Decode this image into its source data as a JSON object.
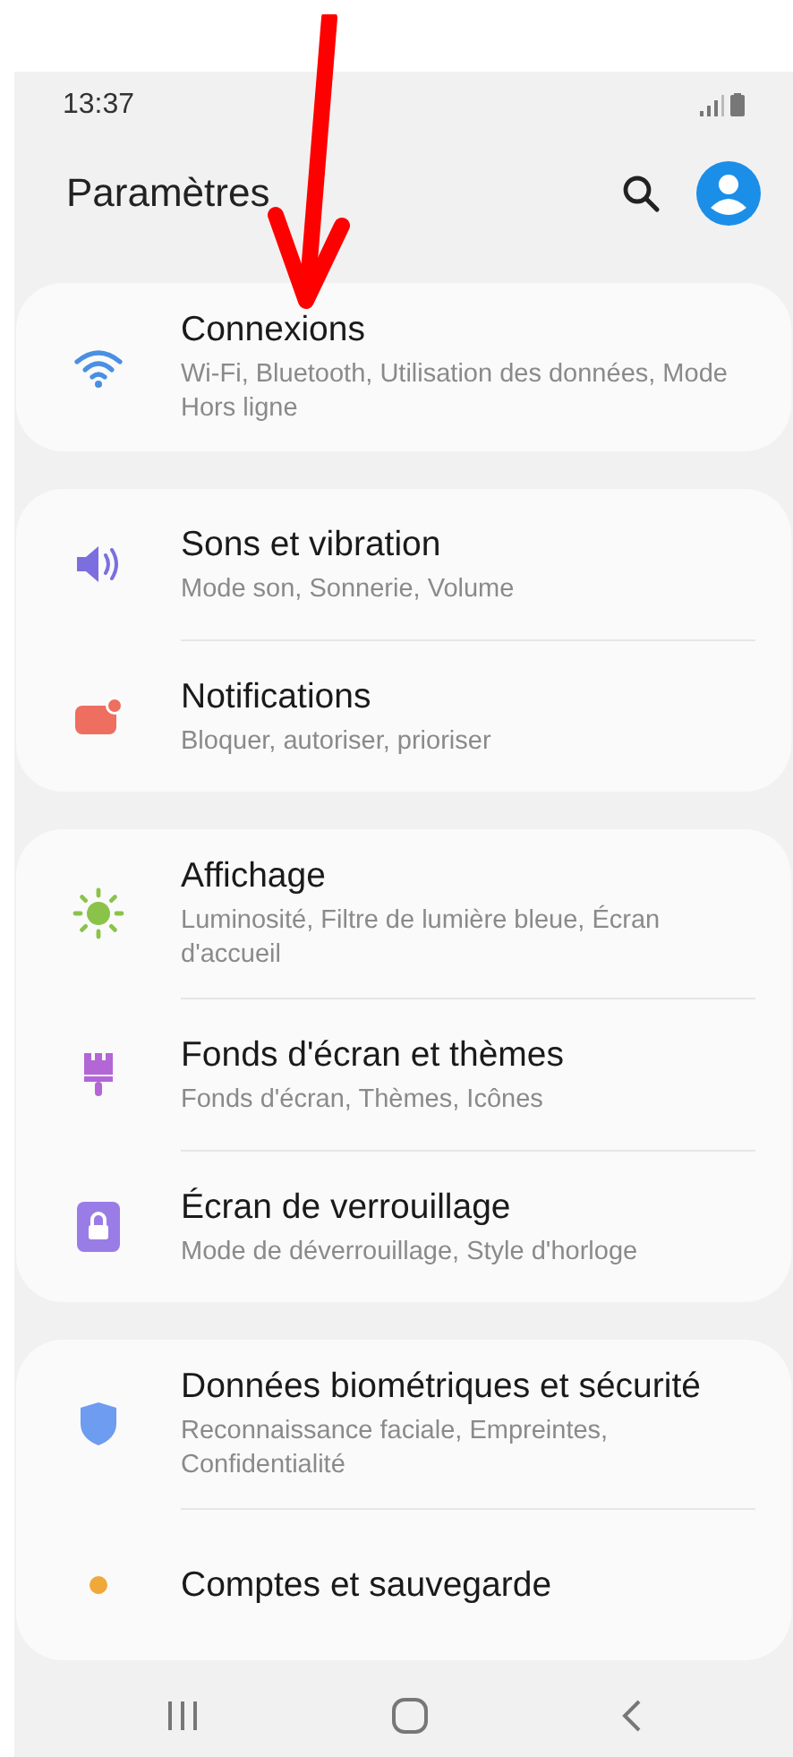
{
  "status_bar": {
    "time": "13:37"
  },
  "header": {
    "title": "Paramètres"
  },
  "groups": [
    {
      "items": [
        {
          "kind": "wifi",
          "title": "Connexions",
          "subtitle": "Wi-Fi, Bluetooth, Utilisation des données, Mode Hors ligne"
        }
      ]
    },
    {
      "items": [
        {
          "kind": "sound",
          "title": "Sons et vibration",
          "subtitle": "Mode son, Sonnerie, Volume"
        },
        {
          "kind": "notifications",
          "title": "Notifications",
          "subtitle": "Bloquer, autoriser, prioriser"
        }
      ]
    },
    {
      "items": [
        {
          "kind": "display",
          "title": "Affichage",
          "subtitle": "Luminosité, Filtre de lumière bleue, Écran d'accueil"
        },
        {
          "kind": "wallpaper",
          "title": "Fonds d'écran et thèmes",
          "subtitle": "Fonds d'écran, Thèmes, Icônes"
        },
        {
          "kind": "lock",
          "title": "Écran de verrouillage",
          "subtitle": "Mode de déverrouillage, Style d'horloge"
        }
      ]
    },
    {
      "items": [
        {
          "kind": "security",
          "title": "Données biométriques et sécurité",
          "subtitle": "Reconnaissance faciale, Empreintes, Confidentialité"
        },
        {
          "kind": "accounts",
          "title": "Comptes et sauvegarde"
        }
      ]
    }
  ]
}
